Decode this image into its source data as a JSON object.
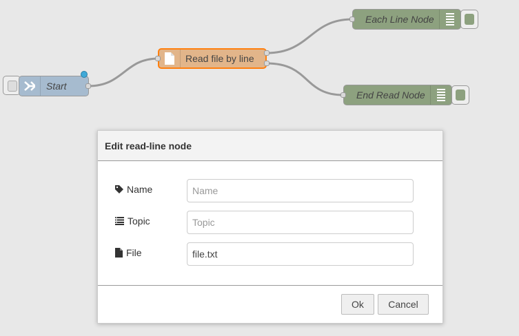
{
  "colors": {
    "canvas_bg": "#e8e8e8",
    "inject_node": "#a6bbcf",
    "read_node": "#e2b58a",
    "read_node_border": "#ff7f0e",
    "debug_node": "#8da17f",
    "wire": "#999999",
    "status_dot": "#3fa9d8"
  },
  "flow": {
    "nodes": {
      "start": {
        "label": "Start",
        "icon": "arrow-in-icon"
      },
      "read_file": {
        "label": "Read file by line",
        "icon": "file-icon"
      },
      "each_line": {
        "label": "Each Line Node",
        "icon": "list-lines-icon"
      },
      "end_read": {
        "label": "End Read Node",
        "icon": "list-lines-icon"
      }
    }
  },
  "dialog": {
    "title": "Edit read-line node",
    "fields": {
      "name": {
        "label": "Name",
        "placeholder": "Name",
        "value": "",
        "icon": "tag-icon"
      },
      "topic": {
        "label": "Topic",
        "placeholder": "Topic",
        "value": "",
        "icon": "topic-list-icon"
      },
      "file": {
        "label": "File",
        "placeholder": "",
        "value": "file.txt",
        "icon": "file-icon"
      }
    },
    "buttons": {
      "ok": "Ok",
      "cancel": "Cancel"
    }
  }
}
